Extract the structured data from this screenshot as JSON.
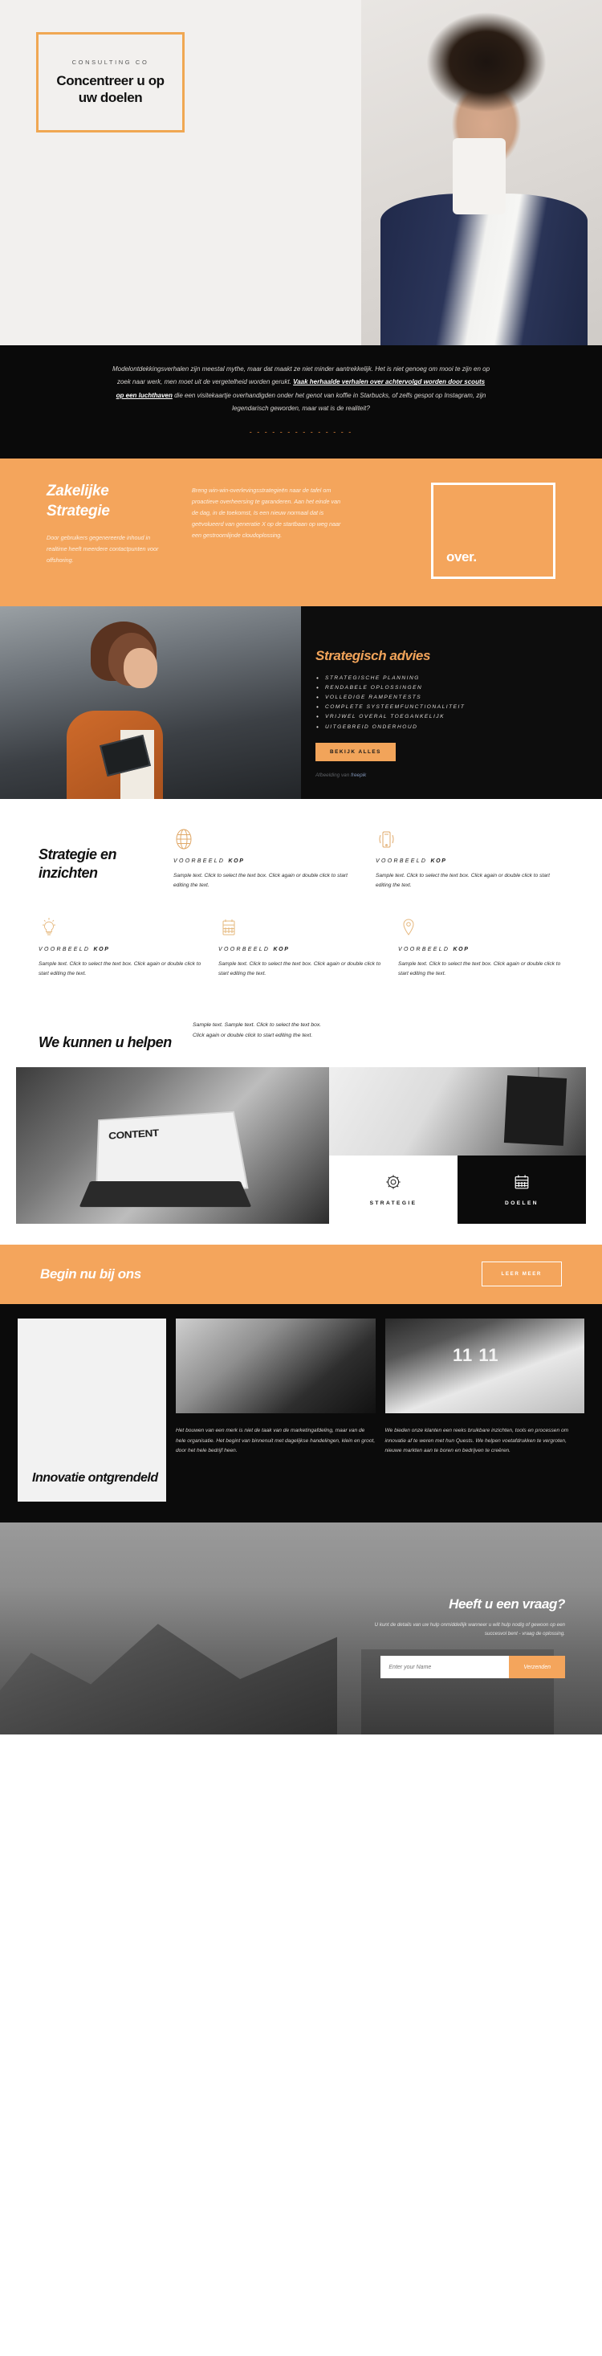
{
  "hero": {
    "eyebrow": "CONSULTING CO",
    "title": "Concentreer u op uw doelen"
  },
  "quote": {
    "part1": "Modelontdekkingsverhalen zijn meestal mythe, maar dat maakt ze niet minder aantrekkelijk. Het is niet genoeg om mooi te zijn en op zoek naar werk, men moet uit de vergetelheid worden gerukt. ",
    "highlight": "Vaak herhaalde verhalen over achtervolgd worden door scouts op een luchthaven",
    "part2": " die een visitekaartje overhandigden onder het genot van koffie in Starbucks, of zelfs gespot op Instagram, zijn legendarisch geworden, maar wat is de realiteit?",
    "dashes": "- - - - - - - - - - - - - -"
  },
  "strategy": {
    "title": "Zakelijke Strategie",
    "subtitle": "Door gebruikers gegenereerde inhoud in realtime heeft meerdere contactpunten voor offshoring.",
    "body": "Breng win-win-overlevingsstrategieën naar de tafel om proactieve overheersing te garanderen. Aan het einde van de dag, in de toekomst, Is een nieuw normaal dat is geëvolueerd van generatie X op de startbaan op weg naar een gestroomlijnde cloudoplossing.",
    "box_label": "over."
  },
  "advice": {
    "title": "Strategisch advies",
    "items": [
      "STRATEGISCHE PLANNING",
      "RENDABELE OPLOSSINGEN",
      "VOLLEDIGE RAMPENTESTS",
      "COMPLETE SYSTEEMFUNCTIONALITEIT",
      "VRIJWEL OVERAL TOEGANKELIJK",
      "UITGEBREID ONDERHOUD"
    ],
    "button": "BEKIJK ALLES",
    "credit_prefix": "Afbeelding van ",
    "credit_link": "freepik"
  },
  "features": {
    "heading": "Strategie en inzichten",
    "cards": [
      {
        "icon": "globe-icon",
        "kop_light": "VOORBEELD ",
        "kop_bold": "KOP",
        "body": "Sample text. Click to select the text box. Click again or double click to start editing the text."
      },
      {
        "icon": "mobile-icon",
        "kop_light": "VOORBEELD ",
        "kop_bold": "KOP",
        "body": "Sample text. Click to select the text box. Click again or double click to start editing the text."
      },
      {
        "icon": "lightbulb-icon",
        "kop_light": "VOORBEELD ",
        "kop_bold": "KOP",
        "body": "Sample text. Click to select the text box. Click again or double click to start editing the text."
      },
      {
        "icon": "calendar-icon",
        "kop_light": "VOORBEELD ",
        "kop_bold": "KOP",
        "body": "Sample text. Click to select the text box. Click again or double click to start editing the text."
      },
      {
        "icon": "location-pin-icon",
        "kop_light": "VOORBEELD ",
        "kop_bold": "KOP",
        "body": "Sample text. Click to select the text box. Click again or double click to start editing the text."
      }
    ]
  },
  "help": {
    "title": "We kunnen u helpen",
    "body": "Sample text. Sample text. Click to select the text box. Click again or double click to start editing the text.",
    "box_strategy": "STRATEGIE",
    "box_goals": "DOELEN",
    "laptop_label": "CONTENT"
  },
  "cta": {
    "title": "Begin nu bij ons",
    "button": "LEER MEER"
  },
  "innovation": {
    "title": "Innovatie ontgrendeld",
    "col1": "Het bouwen van een merk is niet de taak van de marketingafdeling, maar van de hele organisatie. Het begint van binnenuit met dagelijkse handelingen, klein en groot, door het hele bedrijf heen.",
    "col2": "We bieden onze klanten een reeks bruikbare inzichten, tools en processen om innovatie af te weren met hun Quests. We helpen voetafdrukken te vergroten, nieuwe markten aan te boren en bedrijven te creëren.",
    "photo2_number": "11 11"
  },
  "footer": {
    "title": "Heeft u een vraag?",
    "body": "U kunt de details van uw hulp onmiddellijk wanneer u wilt hulp nodig of gewoon op een succesvol bent - vraag de oplossing.",
    "input_placeholder": "Enter your Name",
    "submit": "Verzenden"
  },
  "colors": {
    "accent": "#f4a55c",
    "dark": "#0b0b0b",
    "advice_accent": "#f2a45a"
  }
}
